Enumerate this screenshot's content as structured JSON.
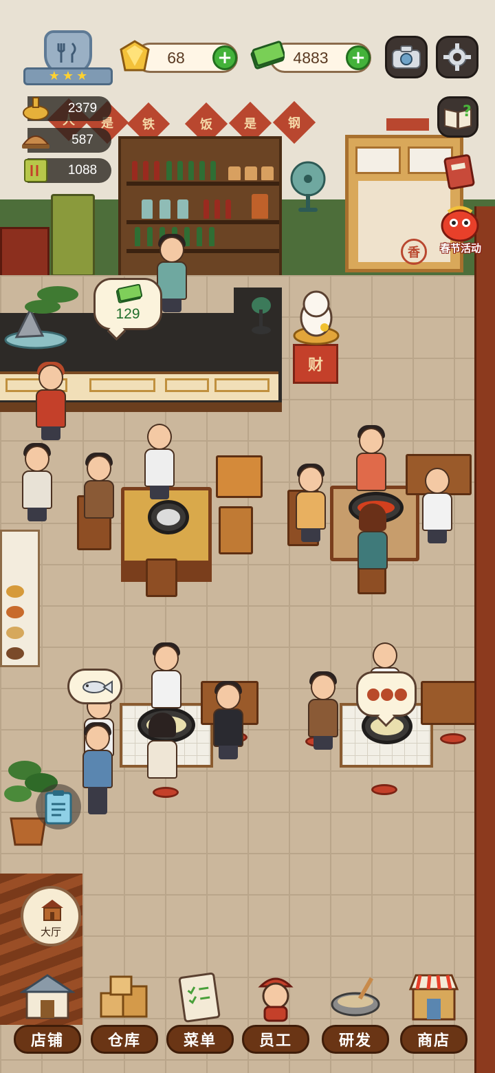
{
  "currency": {
    "gems": "68",
    "cash": "4883"
  },
  "stats": [
    {
      "icon": "hotpot-icon",
      "value": "2379"
    },
    {
      "icon": "serving-dish-icon",
      "value": "587"
    },
    {
      "icon": "recipe-book-icon",
      "value": "1088"
    }
  ],
  "scene": {
    "wall_banner": [
      "人",
      "是",
      "铁",
      "饭",
      "是",
      "钢"
    ],
    "door_sign": "香",
    "lucky_cat_sign": "财",
    "counter_tip": "129"
  },
  "side_buttons": {
    "event_label": "春节活动"
  },
  "hall_button": {
    "label": "大厅"
  },
  "nav": [
    {
      "icon": "storefront-icon",
      "label": "店铺"
    },
    {
      "icon": "warehouse-boxes-icon",
      "label": "仓库"
    },
    {
      "icon": "menu-clipboard-icon",
      "label": "菜单"
    },
    {
      "icon": "staff-chef-icon",
      "label": "员工"
    },
    {
      "icon": "research-wok-icon",
      "label": "研发"
    },
    {
      "icon": "shop-icon",
      "label": "商店"
    }
  ],
  "colors": {
    "accent_green": "#43b23a",
    "nav_brown": "#6a3515",
    "banner_red": "#b9472f",
    "star_gold": "#ffd230"
  }
}
